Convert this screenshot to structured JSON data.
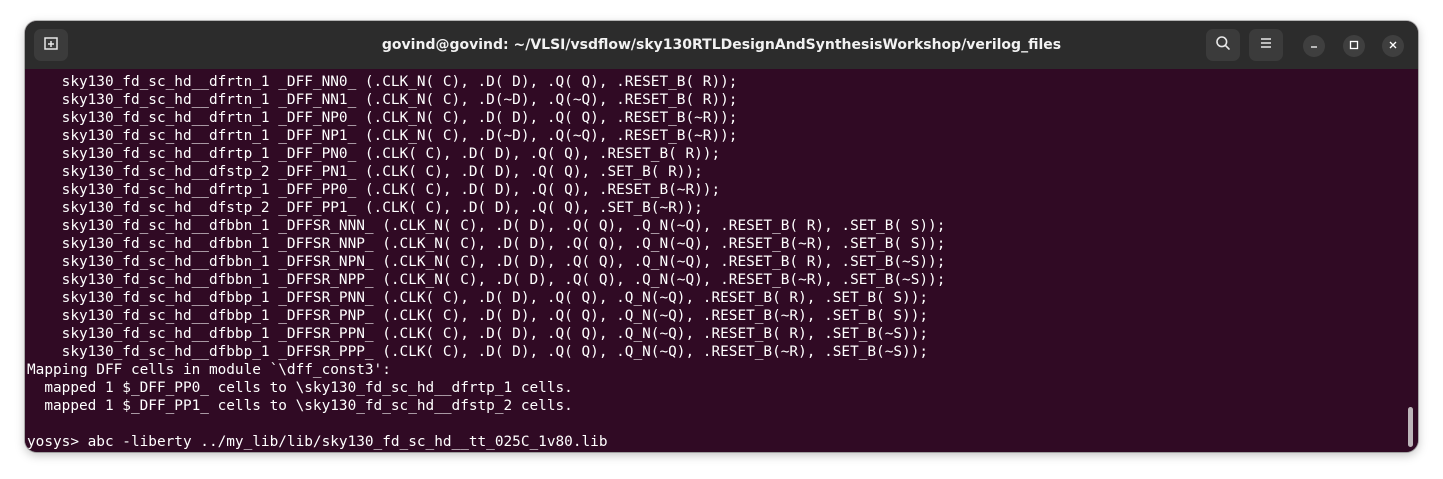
{
  "window": {
    "title": "govind@govind: ~/VLSI/vsdflow/sky130RTLDesignAndSynthesisWorkshop/verilog_files"
  },
  "titlebar_icons": {
    "new_tab": "new-tab-icon",
    "search": "search-icon",
    "menu": "hamburger-menu-icon",
    "minimize": "minimize-icon",
    "maximize": "maximize-icon",
    "close": "close-icon"
  },
  "colors": {
    "terminal_bg": "#300a24",
    "titlebar_bg": "#2c2c2c",
    "text": "#ffffff"
  },
  "terminal": {
    "lines": [
      "    sky130_fd_sc_hd__dfrtn_1 _DFF_NN0_ (.CLK_N( C), .D( D), .Q( Q), .RESET_B( R));",
      "    sky130_fd_sc_hd__dfrtn_1 _DFF_NN1_ (.CLK_N( C), .D(~D), .Q(~Q), .RESET_B( R));",
      "    sky130_fd_sc_hd__dfrtn_1 _DFF_NP0_ (.CLK_N( C), .D( D), .Q( Q), .RESET_B(~R));",
      "    sky130_fd_sc_hd__dfrtn_1 _DFF_NP1_ (.CLK_N( C), .D(~D), .Q(~Q), .RESET_B(~R));",
      "    sky130_fd_sc_hd__dfrtp_1 _DFF_PN0_ (.CLK( C), .D( D), .Q( Q), .RESET_B( R));",
      "    sky130_fd_sc_hd__dfstp_2 _DFF_PN1_ (.CLK( C), .D( D), .Q( Q), .SET_B( R));",
      "    sky130_fd_sc_hd__dfrtp_1 _DFF_PP0_ (.CLK( C), .D( D), .Q( Q), .RESET_B(~R));",
      "    sky130_fd_sc_hd__dfstp_2 _DFF_PP1_ (.CLK( C), .D( D), .Q( Q), .SET_B(~R));",
      "    sky130_fd_sc_hd__dfbbn_1 _DFFSR_NNN_ (.CLK_N( C), .D( D), .Q( Q), .Q_N(~Q), .RESET_B( R), .SET_B( S));",
      "    sky130_fd_sc_hd__dfbbn_1 _DFFSR_NNP_ (.CLK_N( C), .D( D), .Q( Q), .Q_N(~Q), .RESET_B(~R), .SET_B( S));",
      "    sky130_fd_sc_hd__dfbbn_1 _DFFSR_NPN_ (.CLK_N( C), .D( D), .Q( Q), .Q_N(~Q), .RESET_B( R), .SET_B(~S));",
      "    sky130_fd_sc_hd__dfbbn_1 _DFFSR_NPP_ (.CLK_N( C), .D( D), .Q( Q), .Q_N(~Q), .RESET_B(~R), .SET_B(~S));",
      "    sky130_fd_sc_hd__dfbbp_1 _DFFSR_PNN_ (.CLK( C), .D( D), .Q( Q), .Q_N(~Q), .RESET_B( R), .SET_B( S));",
      "    sky130_fd_sc_hd__dfbbp_1 _DFFSR_PNP_ (.CLK( C), .D( D), .Q( Q), .Q_N(~Q), .RESET_B(~R), .SET_B( S));",
      "    sky130_fd_sc_hd__dfbbp_1 _DFFSR_PPN_ (.CLK( C), .D( D), .Q( Q), .Q_N(~Q), .RESET_B( R), .SET_B(~S));",
      "    sky130_fd_sc_hd__dfbbp_1 _DFFSR_PPP_ (.CLK( C), .D( D), .Q( Q), .Q_N(~Q), .RESET_B(~R), .SET_B(~S));",
      "Mapping DFF cells in module `\\dff_const3':",
      "  mapped 1 $_DFF_PP0_ cells to \\sky130_fd_sc_hd__dfrtp_1 cells.",
      "  mapped 1 $_DFF_PP1_ cells to \\sky130_fd_sc_hd__dfstp_2 cells.",
      "",
      "yosys> abc -liberty ../my_lib/lib/sky130_fd_sc_hd__tt_025C_1v80.lib"
    ]
  }
}
